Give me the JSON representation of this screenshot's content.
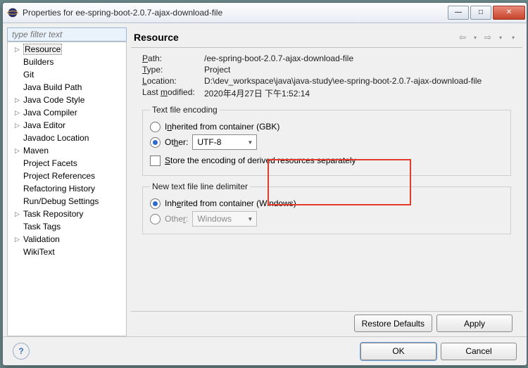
{
  "window": {
    "title": "Properties for ee-spring-boot-2.0.7-ajax-download-file"
  },
  "sidebar": {
    "filter_placeholder": "type filter text",
    "items": [
      {
        "label": "Resource",
        "expandable": true,
        "selected": true
      },
      {
        "label": "Builders"
      },
      {
        "label": "Git"
      },
      {
        "label": "Java Build Path"
      },
      {
        "label": "Java Code Style",
        "expandable": true
      },
      {
        "label": "Java Compiler",
        "expandable": true
      },
      {
        "label": "Java Editor",
        "expandable": true
      },
      {
        "label": "Javadoc Location"
      },
      {
        "label": "Maven",
        "expandable": true
      },
      {
        "label": "Project Facets"
      },
      {
        "label": "Project References"
      },
      {
        "label": "Refactoring History"
      },
      {
        "label": "Run/Debug Settings"
      },
      {
        "label": "Task Repository",
        "expandable": true
      },
      {
        "label": "Task Tags"
      },
      {
        "label": "Validation",
        "expandable": true
      },
      {
        "label": "WikiText"
      }
    ]
  },
  "main": {
    "title": "Resource",
    "path_label": "Path:",
    "path_value": "/ee-spring-boot-2.0.7-ajax-download-file",
    "type_label": "Type:",
    "type_value": "Project",
    "location_label": "Location:",
    "location_value": "D:\\dev_workspace\\java\\java-study\\ee-spring-boot-2.0.7-ajax-download-file",
    "last_modified_label": "Last modified:",
    "last_modified_value": "2020年4月27日 下午1:52:14",
    "encoding": {
      "legend": "Text file encoding",
      "inherited_label": "Inherited from container (GBK)",
      "other_label": "Other:",
      "other_value": "UTF-8",
      "store_label": "Store the encoding of derived resources separately"
    },
    "delimiter": {
      "legend": "New text file line delimiter",
      "inherited_label": "Inherited from container (Windows)",
      "other_label": "Other:",
      "other_value": "Windows"
    },
    "restore_defaults": "Restore Defaults",
    "apply": "Apply"
  },
  "footer": {
    "ok": "OK",
    "cancel": "Cancel"
  }
}
